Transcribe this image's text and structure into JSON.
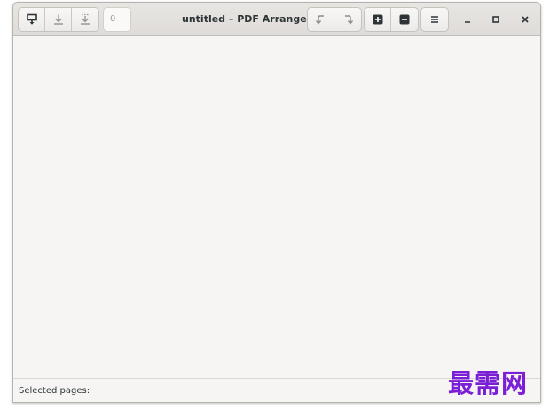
{
  "window": {
    "title": "untitled – PDF Arranger"
  },
  "toolbar": {
    "file_buttons": [
      {
        "icon": "import-icon",
        "tooltip": ""
      },
      {
        "icon": "save-icon",
        "tooltip": ""
      },
      {
        "icon": "save-as-icon",
        "tooltip": ""
      }
    ],
    "zoom_value": "0",
    "rotate_buttons": [
      {
        "icon": "rotate-left-icon"
      },
      {
        "icon": "rotate-right-icon"
      }
    ],
    "zoom_buttons": [
      {
        "icon": "zoom-in-icon"
      },
      {
        "icon": "zoom-out-icon"
      }
    ],
    "menu_icon": "hamburger-menu-icon"
  },
  "window_controls": {
    "minimize_icon": "minimize-icon",
    "maximize_icon": "maximize-icon",
    "close_icon": "close-icon"
  },
  "statusbar": {
    "label": "Selected pages:"
  },
  "watermark": {
    "text": "最需网"
  },
  "colors": {
    "headerbar": "#dedbd8",
    "content_bg": "#f6f5f4",
    "watermark": "#7b1fd6"
  }
}
